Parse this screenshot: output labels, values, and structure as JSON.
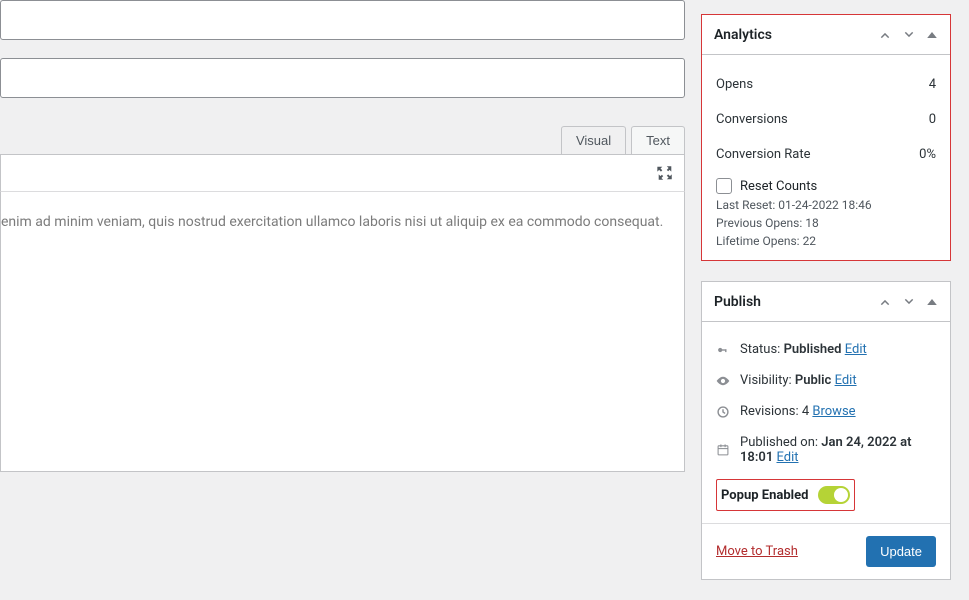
{
  "editor": {
    "tabs": {
      "visual": "Visual",
      "text": "Text"
    },
    "content": "enim ad minim veniam, quis nostrud exercitation ullamco laboris nisi ut aliquip ex ea commodo consequat."
  },
  "analytics": {
    "title": "Analytics",
    "rows": {
      "opens": {
        "label": "Opens",
        "value": "4"
      },
      "conversions": {
        "label": "Conversions",
        "value": "0"
      },
      "conversionRate": {
        "label": "Conversion Rate",
        "value": "0%"
      }
    },
    "reset": {
      "label": "Reset Counts"
    },
    "meta": {
      "lastResetLabel": "Last Reset:",
      "lastResetValue": "01-24-2022 18:46",
      "previousOpensLabel": "Previous Opens:",
      "previousOpensValue": "18",
      "lifetimeOpensLabel": "Lifetime Opens:",
      "lifetimeOpensValue": "22"
    }
  },
  "publish": {
    "title": "Publish",
    "status": {
      "label": "Status:",
      "value": "Published",
      "action": "Edit"
    },
    "visibility": {
      "label": "Visibility:",
      "value": "Public",
      "action": "Edit"
    },
    "revisions": {
      "label": "Revisions:",
      "value": "4",
      "action": "Browse"
    },
    "publishedOn": {
      "label": "Published on:",
      "value": "Jan 24, 2022 at 18:01",
      "action": "Edit"
    },
    "popup": {
      "label": "Popup Enabled"
    },
    "trash": "Move to Trash",
    "update": "Update"
  }
}
